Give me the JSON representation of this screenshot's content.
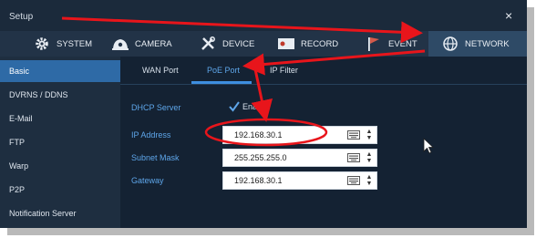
{
  "window": {
    "title": "Setup",
    "close_symbol": "×"
  },
  "tabs": [
    {
      "label": "SYSTEM",
      "icon": "gear-icon"
    },
    {
      "label": "CAMERA",
      "icon": "camera-icon"
    },
    {
      "label": "DEVICE",
      "icon": "tools-icon"
    },
    {
      "label": "RECORD",
      "icon": "record-icon"
    },
    {
      "label": "EVENT",
      "icon": "flag-icon"
    },
    {
      "label": "NETWORK",
      "icon": "globe-icon",
      "active": true
    }
  ],
  "sidebar": {
    "items": [
      {
        "label": "Basic",
        "active": true
      },
      {
        "label": "DVRNS / DDNS"
      },
      {
        "label": "E-Mail"
      },
      {
        "label": "FTP"
      },
      {
        "label": "Warp"
      },
      {
        "label": "P2P"
      },
      {
        "label": "Notification Server"
      }
    ]
  },
  "subtabs": [
    {
      "label": "WAN Port"
    },
    {
      "label": "PoE Port",
      "active": true
    },
    {
      "label": "IP Filter"
    }
  ],
  "form": {
    "dhcp_label": "DHCP Server",
    "enable_label": "Enab",
    "enable_checked": true,
    "ip_label": "IP Address",
    "ip_value": "192.168.30.1",
    "subnet_label": "Subnet Mask",
    "subnet_value": "255.255.255.0",
    "gateway_label": "Gateway",
    "gateway_value": "192.168.30.1"
  },
  "colors": {
    "annotation": "#e8151b",
    "accent": "#2e6aa6",
    "label": "#5ea6ea"
  }
}
